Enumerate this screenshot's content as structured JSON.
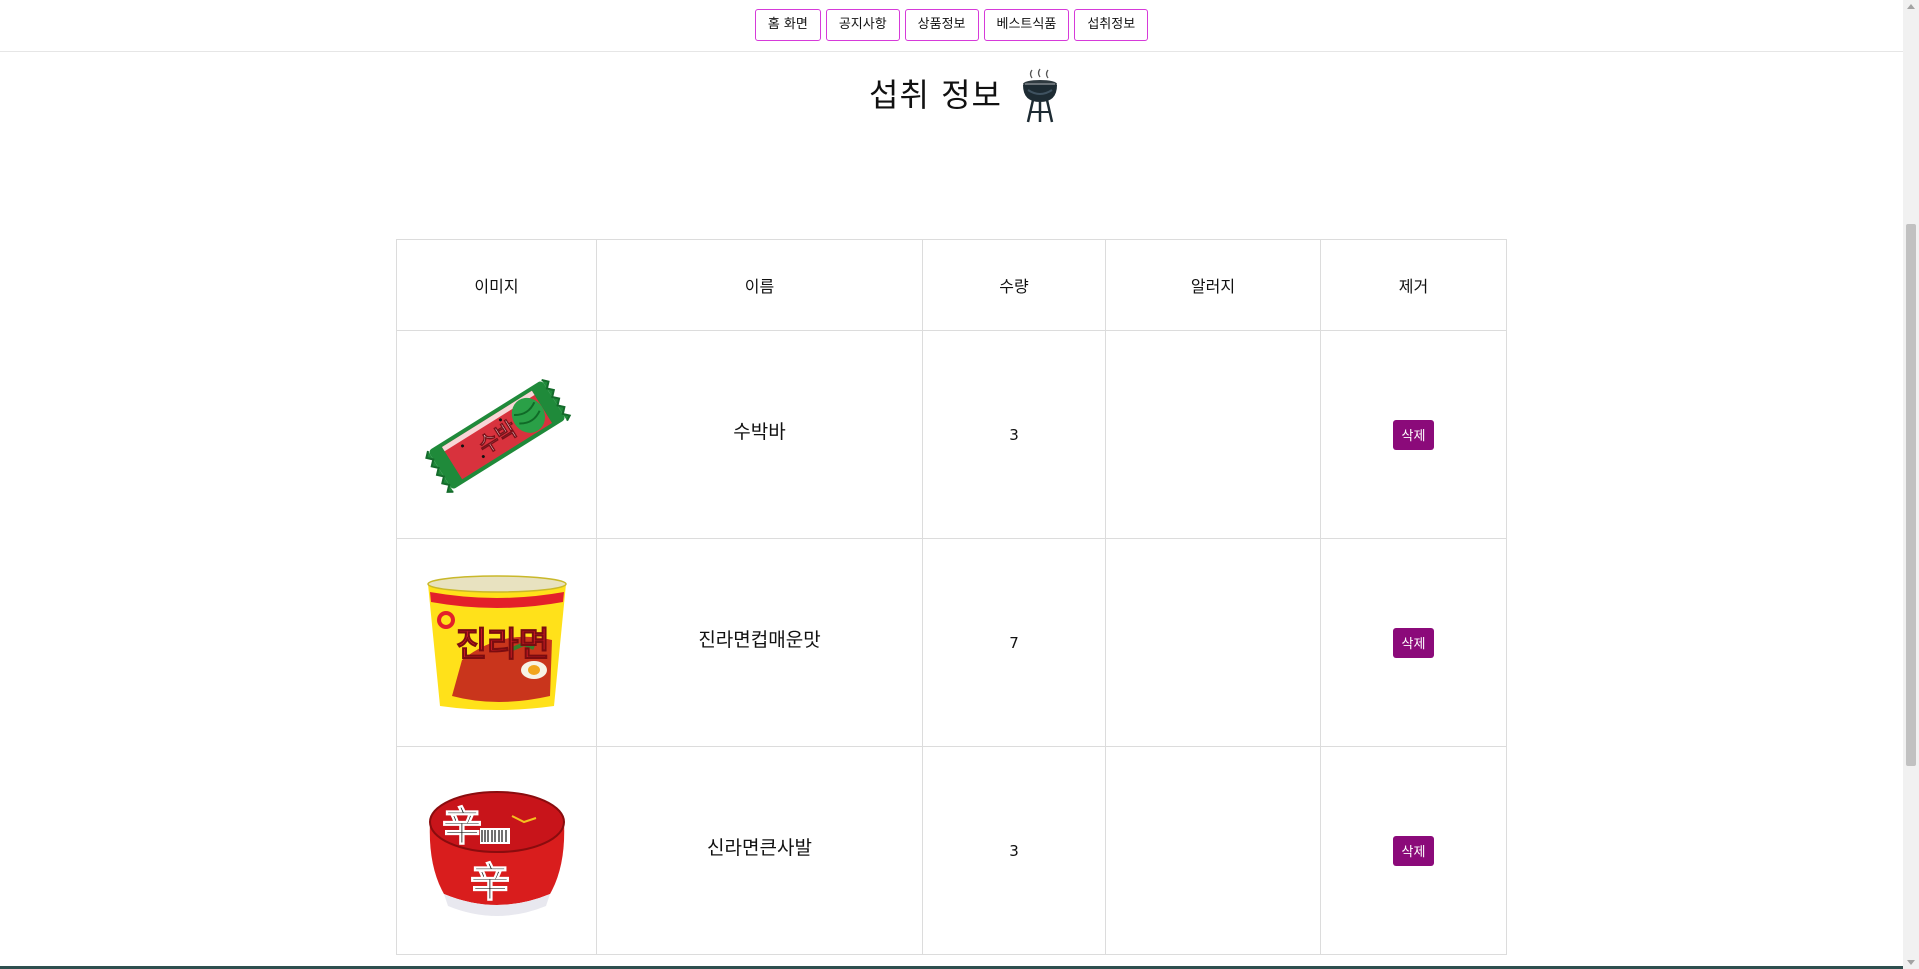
{
  "nav": {
    "items": [
      {
        "label": "홈 화면"
      },
      {
        "label": "공지사항"
      },
      {
        "label": "상품정보"
      },
      {
        "label": "베스트식품"
      },
      {
        "label": "섭취정보"
      }
    ]
  },
  "page": {
    "title": "섭취 정보",
    "title_icon": "grill-icon"
  },
  "table": {
    "headers": {
      "image": "이미지",
      "name": "이름",
      "quantity": "수량",
      "allergy": "알러지",
      "remove": "제거"
    },
    "rows": [
      {
        "image": "watermelon-bar-product-image",
        "name": "수박바",
        "quantity": "3",
        "allergy": "",
        "delete_label": "삭제"
      },
      {
        "image": "jin-ramen-cup-product-image",
        "name": "진라면컵매운맛",
        "quantity": "7",
        "allergy": "",
        "delete_label": "삭제"
      },
      {
        "image": "shin-ramen-bowl-product-image",
        "name": "신라면큰사발",
        "quantity": "3",
        "allergy": "",
        "delete_label": "삭제"
      }
    ]
  },
  "colors": {
    "nav_border": "#d63ad9",
    "delete_button": "#8b0a7a",
    "table_border": "#dcdcdc"
  }
}
